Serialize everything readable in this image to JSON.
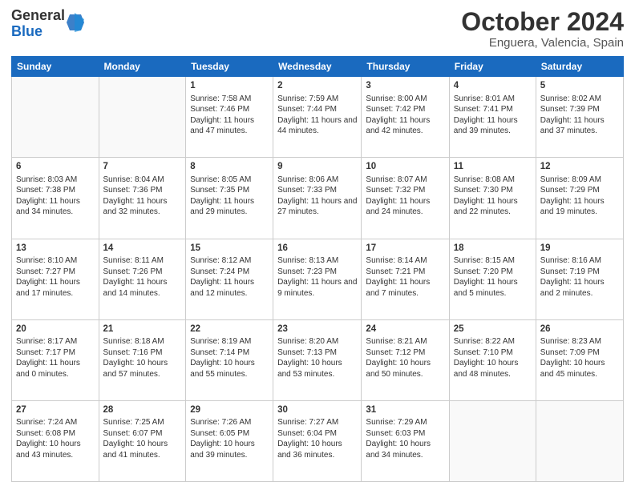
{
  "logo": {
    "general": "General",
    "blue": "Blue"
  },
  "header": {
    "month": "October 2024",
    "location": "Enguera, Valencia, Spain"
  },
  "weekdays": [
    "Sunday",
    "Monday",
    "Tuesday",
    "Wednesday",
    "Thursday",
    "Friday",
    "Saturday"
  ],
  "weeks": [
    [
      {
        "day": "",
        "sunrise": "",
        "sunset": "",
        "daylight": ""
      },
      {
        "day": "",
        "sunrise": "",
        "sunset": "",
        "daylight": ""
      },
      {
        "day": "1",
        "sunrise": "Sunrise: 7:58 AM",
        "sunset": "Sunset: 7:46 PM",
        "daylight": "Daylight: 11 hours and 47 minutes."
      },
      {
        "day": "2",
        "sunrise": "Sunrise: 7:59 AM",
        "sunset": "Sunset: 7:44 PM",
        "daylight": "Daylight: 11 hours and 44 minutes."
      },
      {
        "day": "3",
        "sunrise": "Sunrise: 8:00 AM",
        "sunset": "Sunset: 7:42 PM",
        "daylight": "Daylight: 11 hours and 42 minutes."
      },
      {
        "day": "4",
        "sunrise": "Sunrise: 8:01 AM",
        "sunset": "Sunset: 7:41 PM",
        "daylight": "Daylight: 11 hours and 39 minutes."
      },
      {
        "day": "5",
        "sunrise": "Sunrise: 8:02 AM",
        "sunset": "Sunset: 7:39 PM",
        "daylight": "Daylight: 11 hours and 37 minutes."
      }
    ],
    [
      {
        "day": "6",
        "sunrise": "Sunrise: 8:03 AM",
        "sunset": "Sunset: 7:38 PM",
        "daylight": "Daylight: 11 hours and 34 minutes."
      },
      {
        "day": "7",
        "sunrise": "Sunrise: 8:04 AM",
        "sunset": "Sunset: 7:36 PM",
        "daylight": "Daylight: 11 hours and 32 minutes."
      },
      {
        "day": "8",
        "sunrise": "Sunrise: 8:05 AM",
        "sunset": "Sunset: 7:35 PM",
        "daylight": "Daylight: 11 hours and 29 minutes."
      },
      {
        "day": "9",
        "sunrise": "Sunrise: 8:06 AM",
        "sunset": "Sunset: 7:33 PM",
        "daylight": "Daylight: 11 hours and 27 minutes."
      },
      {
        "day": "10",
        "sunrise": "Sunrise: 8:07 AM",
        "sunset": "Sunset: 7:32 PM",
        "daylight": "Daylight: 11 hours and 24 minutes."
      },
      {
        "day": "11",
        "sunrise": "Sunrise: 8:08 AM",
        "sunset": "Sunset: 7:30 PM",
        "daylight": "Daylight: 11 hours and 22 minutes."
      },
      {
        "day": "12",
        "sunrise": "Sunrise: 8:09 AM",
        "sunset": "Sunset: 7:29 PM",
        "daylight": "Daylight: 11 hours and 19 minutes."
      }
    ],
    [
      {
        "day": "13",
        "sunrise": "Sunrise: 8:10 AM",
        "sunset": "Sunset: 7:27 PM",
        "daylight": "Daylight: 11 hours and 17 minutes."
      },
      {
        "day": "14",
        "sunrise": "Sunrise: 8:11 AM",
        "sunset": "Sunset: 7:26 PM",
        "daylight": "Daylight: 11 hours and 14 minutes."
      },
      {
        "day": "15",
        "sunrise": "Sunrise: 8:12 AM",
        "sunset": "Sunset: 7:24 PM",
        "daylight": "Daylight: 11 hours and 12 minutes."
      },
      {
        "day": "16",
        "sunrise": "Sunrise: 8:13 AM",
        "sunset": "Sunset: 7:23 PM",
        "daylight": "Daylight: 11 hours and 9 minutes."
      },
      {
        "day": "17",
        "sunrise": "Sunrise: 8:14 AM",
        "sunset": "Sunset: 7:21 PM",
        "daylight": "Daylight: 11 hours and 7 minutes."
      },
      {
        "day": "18",
        "sunrise": "Sunrise: 8:15 AM",
        "sunset": "Sunset: 7:20 PM",
        "daylight": "Daylight: 11 hours and 5 minutes."
      },
      {
        "day": "19",
        "sunrise": "Sunrise: 8:16 AM",
        "sunset": "Sunset: 7:19 PM",
        "daylight": "Daylight: 11 hours and 2 minutes."
      }
    ],
    [
      {
        "day": "20",
        "sunrise": "Sunrise: 8:17 AM",
        "sunset": "Sunset: 7:17 PM",
        "daylight": "Daylight: 11 hours and 0 minutes."
      },
      {
        "day": "21",
        "sunrise": "Sunrise: 8:18 AM",
        "sunset": "Sunset: 7:16 PM",
        "daylight": "Daylight: 10 hours and 57 minutes."
      },
      {
        "day": "22",
        "sunrise": "Sunrise: 8:19 AM",
        "sunset": "Sunset: 7:14 PM",
        "daylight": "Daylight: 10 hours and 55 minutes."
      },
      {
        "day": "23",
        "sunrise": "Sunrise: 8:20 AM",
        "sunset": "Sunset: 7:13 PM",
        "daylight": "Daylight: 10 hours and 53 minutes."
      },
      {
        "day": "24",
        "sunrise": "Sunrise: 8:21 AM",
        "sunset": "Sunset: 7:12 PM",
        "daylight": "Daylight: 10 hours and 50 minutes."
      },
      {
        "day": "25",
        "sunrise": "Sunrise: 8:22 AM",
        "sunset": "Sunset: 7:10 PM",
        "daylight": "Daylight: 10 hours and 48 minutes."
      },
      {
        "day": "26",
        "sunrise": "Sunrise: 8:23 AM",
        "sunset": "Sunset: 7:09 PM",
        "daylight": "Daylight: 10 hours and 45 minutes."
      }
    ],
    [
      {
        "day": "27",
        "sunrise": "Sunrise: 7:24 AM",
        "sunset": "Sunset: 6:08 PM",
        "daylight": "Daylight: 10 hours and 43 minutes."
      },
      {
        "day": "28",
        "sunrise": "Sunrise: 7:25 AM",
        "sunset": "Sunset: 6:07 PM",
        "daylight": "Daylight: 10 hours and 41 minutes."
      },
      {
        "day": "29",
        "sunrise": "Sunrise: 7:26 AM",
        "sunset": "Sunset: 6:05 PM",
        "daylight": "Daylight: 10 hours and 39 minutes."
      },
      {
        "day": "30",
        "sunrise": "Sunrise: 7:27 AM",
        "sunset": "Sunset: 6:04 PM",
        "daylight": "Daylight: 10 hours and 36 minutes."
      },
      {
        "day": "31",
        "sunrise": "Sunrise: 7:29 AM",
        "sunset": "Sunset: 6:03 PM",
        "daylight": "Daylight: 10 hours and 34 minutes."
      },
      {
        "day": "",
        "sunrise": "",
        "sunset": "",
        "daylight": ""
      },
      {
        "day": "",
        "sunrise": "",
        "sunset": "",
        "daylight": ""
      }
    ]
  ]
}
